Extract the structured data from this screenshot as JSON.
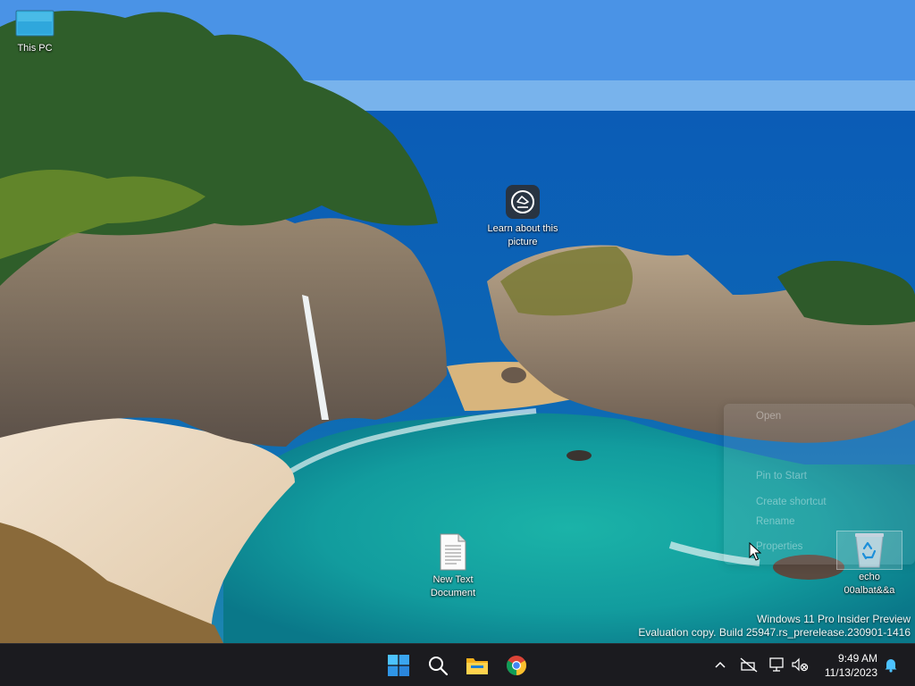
{
  "desktop": {
    "icons": {
      "this_pc": "This PC",
      "learn": "Learn about this picture",
      "new_text": "New Text Document",
      "recycle": "echo 00albat&&a"
    },
    "watermark": {
      "line1": "Windows 11 Pro Insider Preview",
      "line2": "Evaluation copy. Build 25947.rs_prerelease.230901-1416"
    }
  },
  "context_menu": {
    "items": [
      "Open",
      "Pin to Start",
      "Create shortcut",
      "Rename",
      "Properties"
    ]
  },
  "taskbar": {
    "apps": [
      "start-icon",
      "search-icon",
      "file-explorer-icon",
      "chrome-icon"
    ],
    "tray_icons": [
      "chevron-up-icon",
      "network-disconnected-icon",
      "display-icon",
      "volume-muted-icon",
      "notification-bell-icon"
    ],
    "clock": {
      "time": "9:49 AM",
      "date": "11/13/2023"
    }
  },
  "colors": {
    "taskbar": "#1b1b1f",
    "accent": "#3b9cf0"
  }
}
